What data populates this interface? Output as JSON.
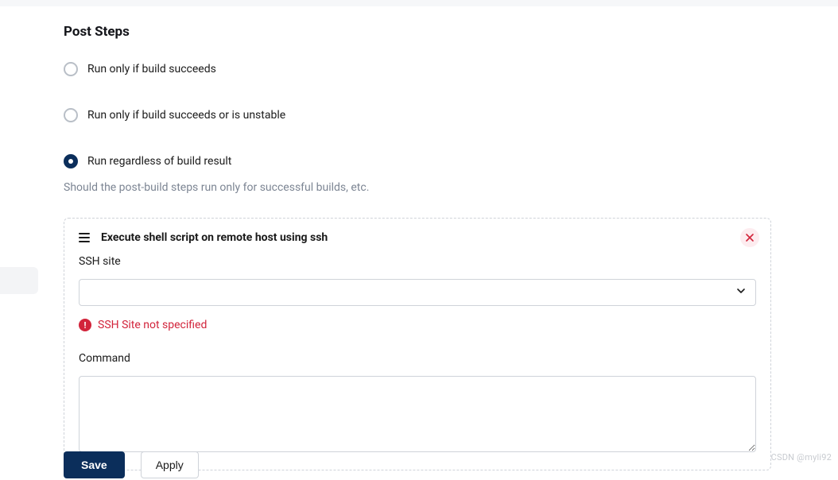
{
  "section": {
    "title": "Post Steps"
  },
  "radios": {
    "opt1": "Run only if build succeeds",
    "opt2": "Run only if build succeeds or is unstable",
    "opt3": "Run regardless of build result",
    "selected": "opt3"
  },
  "help": "Should the post-build steps run only for successful builds, etc.",
  "step": {
    "title": "Execute shell script on remote host using ssh",
    "sshSite": {
      "label": "SSH site",
      "value": "",
      "error": "SSH Site not specified"
    },
    "command": {
      "label": "Command",
      "value": ""
    }
  },
  "actions": {
    "save": "Save",
    "apply": "Apply"
  },
  "watermark": "CSDN @myli92"
}
